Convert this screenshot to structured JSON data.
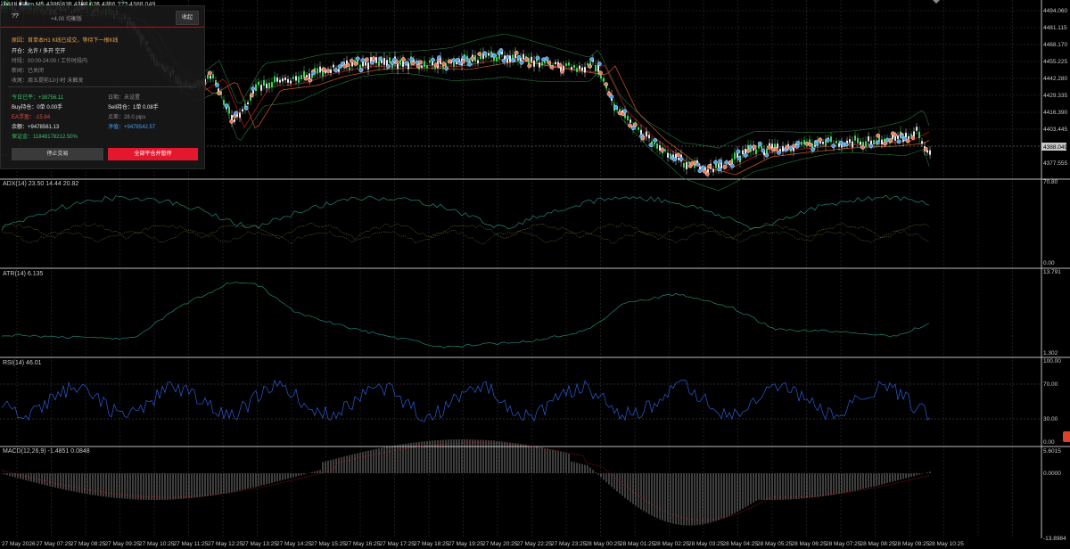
{
  "symbol_header": "XAUUSDm,M5 4386.818 4388.576 4386.??? 4388.049",
  "panel": {
    "title": "??",
    "header_extra": "+4.00 均衡版",
    "collapse_label": "收起",
    "line1": "原因：首单本H1 K线已成交，等待下一根K线",
    "line2": "开仓：允许 / 多开 空开",
    "line3": "时段：00:00-24:00 / 工作时段内",
    "line4": "新闻：已关闭",
    "line5": "收尾：周五提前12小时 未触发",
    "today_label": "今日已平：",
    "today_value": "+38756.11",
    "day_label": "日期：",
    "day_value": "未设置",
    "buy_label": "Buy持仓：",
    "buy_value": "0单  0.00手",
    "sell_label": "Sell持仓：",
    "sell_value": "1单  0.08手",
    "ea_label": "EA浮盈：",
    "ea_value": "-15.84",
    "spread_label": "点差：",
    "spread_value": "28.0 pips",
    "balance_label": "余额：",
    "balance_value": "+9478561.13",
    "equity_label": "净值：",
    "equity_value": "+9478542.57",
    "margin_label": "保证金：",
    "margin_value": "11848178212.50%",
    "stop_label": "停止交易",
    "closeall_label": "全部平仓并暂停"
  },
  "indicators": {
    "adx": "ADX(14) 23.50 14.44 20.82",
    "atr": "ATR(14) 6.135",
    "rsi": "RSI(14) 46.01",
    "macd": "MACD(12,26,9) -1.4851 0.0848"
  },
  "price_axis": [
    "4494.060",
    "4481.115",
    "4468.170",
    "4455.225",
    "4442.280",
    "4429.335",
    "4416.390",
    "4403.445",
    "4388.049",
    "4377.555"
  ],
  "current_price_label": "4388.049",
  "adx_axis": [
    "70.80",
    "0.00"
  ],
  "atr_axis": [
    "13.791",
    "1.302"
  ],
  "rsi_axis": [
    "100.00",
    "70.00",
    "30.00",
    "0.00"
  ],
  "macd_axis": [
    "5.6015",
    "0.0000",
    "-13.8984"
  ],
  "time_axis": [
    "27 May 2026",
    "27 May 07:25",
    "27 May 08:25",
    "27 May 09:25",
    "27 May 10:25",
    "27 May 11:25",
    "27 May 12:25",
    "27 May 13:25",
    "27 May 14:25",
    "27 May 15:25",
    "27 May 16:25",
    "27 May 17:25",
    "27 May 18:25",
    "27 May 19:25",
    "27 May 20:25",
    "27 May 22:25",
    "27 May 23:25",
    "28 May 00:25",
    "28 May 01:25",
    "28 May 02:25",
    "28 May 03:25",
    "28 May 04:25",
    "28 May 05:25",
    "28 May 06:25",
    "28 May 07:25",
    "28 May 08:25",
    "28 May 09:25",
    "28 May 10:25"
  ],
  "colors": {
    "background": "#000000",
    "grid": "#3a3a3a",
    "bull_candle": "#3cd25a",
    "bear_candle": "#e8e8e8",
    "ma_red": "#b01818",
    "ma_orange": "#d05a20",
    "bands": "#1f7a3a",
    "adx_main": "#1f8a7a",
    "atr_line": "#1f8a7a",
    "rsi_line": "#2a5cd8",
    "macd_hist": "#d0d0d0",
    "macd_signal": "#c01818",
    "buy_marker": "#4aa0e8",
    "sell_marker": "#e87a5a"
  }
}
